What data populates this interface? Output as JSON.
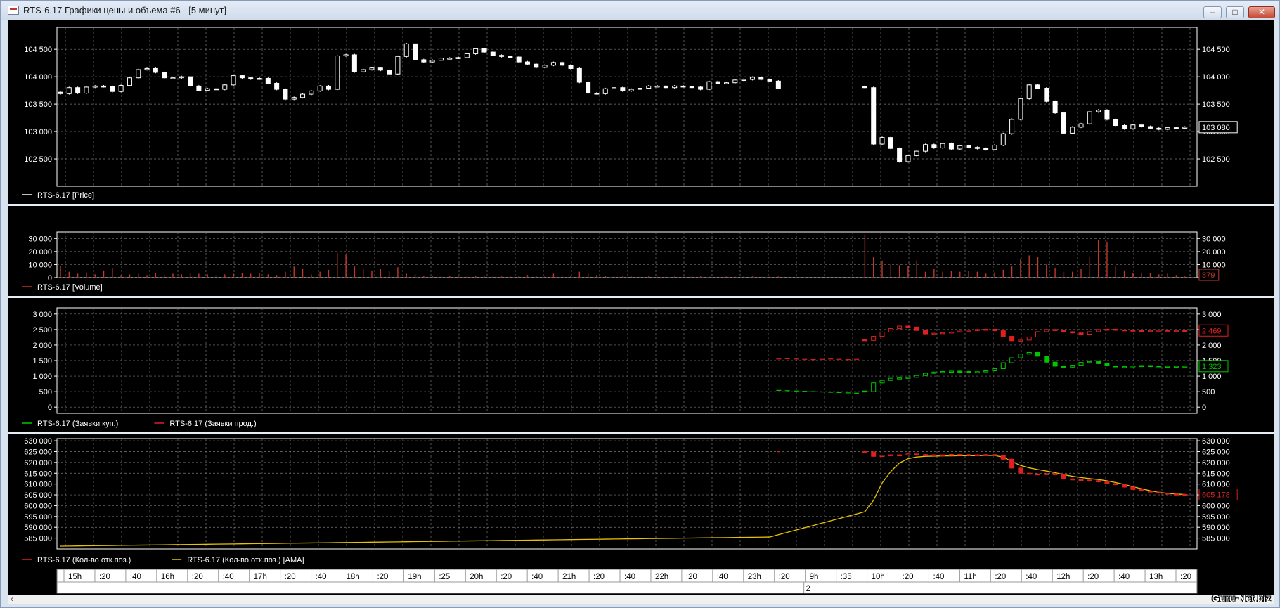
{
  "window": {
    "title": "RTS-6.17 Графики цены и объема #6 - [5 минут]",
    "minimize_icon": "minimize-icon",
    "maximize_icon": "maximize-icon",
    "close_icon": "close-icon"
  },
  "scroll": {
    "left_arrow": "‹"
  },
  "watermark": "Guru-Net.biz",
  "time_axis": {
    "labels": [
      "15h",
      ":20",
      ":40",
      "16h",
      ":20",
      ":40",
      "17h",
      ":20",
      ":40",
      "18h",
      ":20",
      "19h",
      ":25",
      "20h",
      ":20",
      ":40",
      "21h",
      ":20",
      ":40",
      "22h",
      ":20",
      ":40",
      "23h",
      ":20",
      "9h",
      ":35",
      "10h",
      ":20",
      ":40",
      "11h",
      ":20",
      ":40",
      "12h",
      ":20",
      ":40",
      "13h",
      ":20"
    ],
    "date_label": "2"
  },
  "chart_data": [
    {
      "type": "candlestick",
      "legend": [
        "RTS-6.17 [Price]"
      ],
      "yticks": [
        "104 500",
        "104 000",
        "103 500",
        "103 000",
        "102 500"
      ],
      "ylim": [
        102000,
        104900
      ],
      "last_value": "103 080",
      "colors": {
        "series": "#ffffff",
        "grid": "#808080"
      },
      "series": [
        {
          "name": "RTS-6.17 [Price]",
          "segments": [
            [
              103690,
              103800,
              103700,
              103810,
              103830,
              103820,
              103730,
              103840,
              103980,
              104130,
              104150,
              104080,
              103980,
              103980,
              104000,
              103830,
              103750,
              103780,
              103770,
              103850,
              104020,
              103980,
              103960,
              103970,
              103880,
              103770,
              103590,
              103620,
              103680,
              103740,
              103830,
              103770,
              104380,
              104400,
              104090,
              104130,
              104160,
              104120,
              104050,
              104370,
              104600,
              104310,
              104270,
              104300,
              104340,
              104340,
              104350,
              104420,
              104510,
              104450,
              104390,
              104370,
              104360,
              104270,
              104230,
              104170,
              104210,
              104260,
              104210,
              104150,
              103900,
              103700,
              103690,
              103780,
              103800,
              103740,
              103770,
              103790,
              103830,
              103830,
              103800,
              103830,
              103820,
              103810,
              103770,
              103910,
              103880,
              103890,
              103940,
              103950,
              103990,
              103950,
              103920,
              103790
            ],
            [
              103800,
              102770,
              102890,
              102690,
              102450,
              102560,
              102640,
              102760,
              102700,
              102780,
              102680,
              102740,
              102710,
              102690,
              102670,
              102750,
              102960,
              103220,
              103600,
              103850,
              103790,
              103550,
              103340,
              102970,
              103080,
              103140,
              103360,
              103390,
              103220,
              103110,
              103050,
              103120,
              103090,
              103060,
              103040,
              103070,
              103060,
              103080
            ]
          ]
        }
      ]
    },
    {
      "type": "bar",
      "legend": [
        "RTS-6.17 [Volume]"
      ],
      "yticks": [
        "30 000",
        "20 000",
        "10 000",
        "0"
      ],
      "ylim": [
        0,
        35000
      ],
      "last_value": "879",
      "colors": {
        "series": "#c0392b"
      },
      "series": [
        {
          "name": "RTS-6.17 [Volume]",
          "segments": [
            [
              9000,
              4500,
              3000,
              4000,
              2500,
              5500,
              7500,
              2000,
              2500,
              3000,
              2000,
              3500,
              2000,
              3000,
              2500,
              3500,
              3000,
              2500,
              2000,
              2500,
              3000,
              3500,
              3000,
              3500,
              2500,
              2000,
              4500,
              8500,
              7000,
              2500,
              4500,
              6000,
              19000,
              17500,
              8500,
              7000,
              5500,
              6500,
              5000,
              8000,
              3000,
              2500,
              1500,
              1000,
              1000,
              1500,
              1000,
              1200,
              1000,
              1000,
              900,
              900,
              900,
              1500,
              2000,
              1000,
              1000,
              3000,
              1500,
              1000,
              4500,
              3500,
              2000,
              1500,
              1000,
              900,
              900,
              900,
              1000,
              800,
              900,
              800,
              800,
              800,
              900,
              800,
              800,
              800,
              800,
              800,
              900,
              800,
              800,
              900
            ],
            [
              33000,
              16000,
              13000,
              10000,
              9500,
              9000,
              13000,
              4500,
              7000,
              4500,
              5000,
              4500,
              5000,
              4500,
              3000,
              4000,
              6000,
              8500,
              14000,
              17000,
              16000,
              10000,
              7500,
              4500,
              4500,
              6500,
              16000,
              28500,
              27500,
              8500,
              5500,
              3500,
              3500,
              3500,
              2500,
              3000,
              2000,
              879
            ]
          ]
        }
      ]
    },
    {
      "type": "candlestick",
      "legend": [
        "RTS-6.17 (Заявки куп.)",
        "RTS-6.17 (Заявки прод.)"
      ],
      "yticks": [
        "3 000",
        "2 500",
        "2 000",
        "1 500",
        "1 000",
        "500",
        "0"
      ],
      "ylim": [
        -200,
        3200
      ],
      "last_values": [
        "2 469",
        "1 323"
      ],
      "colors": {
        "buy": "#00c800",
        "sell": "#e02020"
      },
      "series": [
        {
          "name": "RTS-6.17 (Заявки прод.)",
          "pre": [
            1550,
            1560,
            1550,
            1540,
            1530,
            1540,
            1550,
            1540,
            1530,
            1540
          ],
          "values": [
            2150,
            2280,
            2420,
            2530,
            2610,
            2580,
            2470,
            2360,
            2380,
            2400,
            2420,
            2450,
            2480,
            2500,
            2510,
            2460,
            2280,
            2140,
            2160,
            2260,
            2430,
            2500,
            2470,
            2430,
            2390,
            2350,
            2430,
            2500,
            2510,
            2490,
            2480,
            2470,
            2460,
            2470,
            2480,
            2470,
            2470,
            2469
          ]
        },
        {
          "name": "RTS-6.17 (Заявки куп.)",
          "pre": [
            540,
            530,
            520,
            510,
            500,
            490,
            480,
            470,
            460,
            450
          ],
          "values": [
            500,
            780,
            860,
            930,
            940,
            960,
            1020,
            1090,
            1130,
            1150,
            1160,
            1150,
            1130,
            1140,
            1170,
            1240,
            1430,
            1590,
            1710,
            1760,
            1640,
            1450,
            1320,
            1290,
            1350,
            1440,
            1470,
            1400,
            1330,
            1300,
            1310,
            1330,
            1340,
            1330,
            1320,
            1320,
            1320,
            1323
          ]
        }
      ]
    },
    {
      "type": "line",
      "legend": [
        "RTS-6.17 (Кол-во отк.поз.)",
        "RTS-6.17 (Кол-во отк.поз.) [AMA]"
      ],
      "yticks": [
        "630 000",
        "625 000",
        "620 000",
        "615 000",
        "610 000",
        "605 000",
        "600 000",
        "595 000",
        "590 000",
        "585 000"
      ],
      "ylim": [
        580000,
        631000
      ],
      "last_value": "605 178",
      "colors": {
        "oi": "#e02020",
        "ama": "#e6c200"
      },
      "series": [
        {
          "name": "RTS-6.17 (Кол-во отк.поз.)",
          "pre_value": 625000,
          "values": [
            624800,
            622800,
            623200,
            623500,
            623400,
            623900,
            623600,
            623200,
            623500,
            623300,
            623700,
            623600,
            623400,
            623500,
            623600,
            623300,
            621500,
            617400,
            615000,
            614700,
            614400,
            614800,
            614500,
            612400,
            612100,
            611900,
            611600,
            611000,
            610200,
            609700,
            608600,
            607500,
            606800,
            606300,
            605800,
            605400,
            605200,
            605178
          ]
        },
        {
          "name": "RTS-6.17 (Кол-во отк.поз.) [AMA]",
          "start": 581300,
          "pre_end": 585500,
          "values": [
            597200,
            602500,
            610500,
            615800,
            619800,
            621700,
            622500,
            622800,
            622900,
            623000,
            623000,
            623100,
            623100,
            623100,
            623200,
            623200,
            622400,
            620400,
            618600,
            617500,
            616700,
            616000,
            615300,
            614300,
            613600,
            613000,
            612500,
            612100,
            611500,
            610700,
            609800,
            608800,
            607800,
            606900,
            606200,
            605700,
            605400,
            605178
          ]
        }
      ]
    }
  ]
}
